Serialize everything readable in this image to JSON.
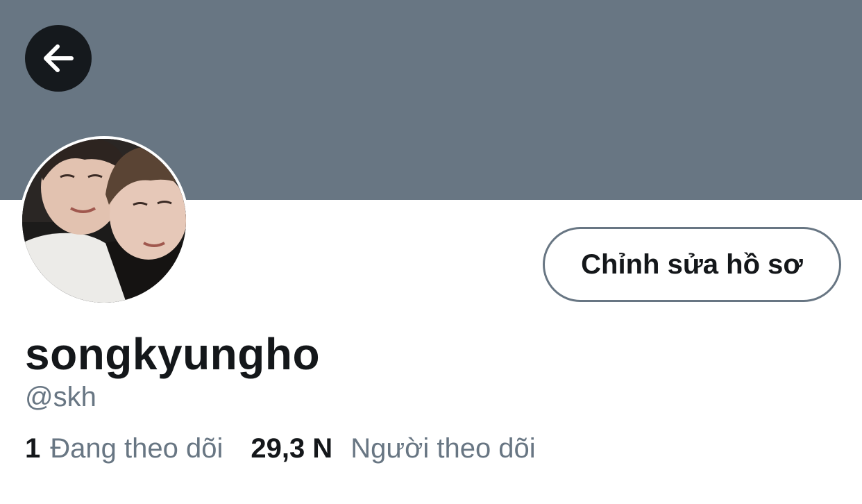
{
  "header": {
    "banner_color": "#687683",
    "back_icon": "arrow-left-icon"
  },
  "profile": {
    "avatar_icon": "profile-photo",
    "edit_button_label": "Chỉnh sửa hồ sơ",
    "display_name": "songkyungho",
    "handle": "@skh"
  },
  "stats": {
    "following_count": "1",
    "following_label": "Đang theo dõi",
    "followers_count": "29,3 N",
    "followers_label": "Người theo dõi"
  },
  "colors": {
    "text_primary": "#14171a",
    "text_secondary": "#687683"
  }
}
